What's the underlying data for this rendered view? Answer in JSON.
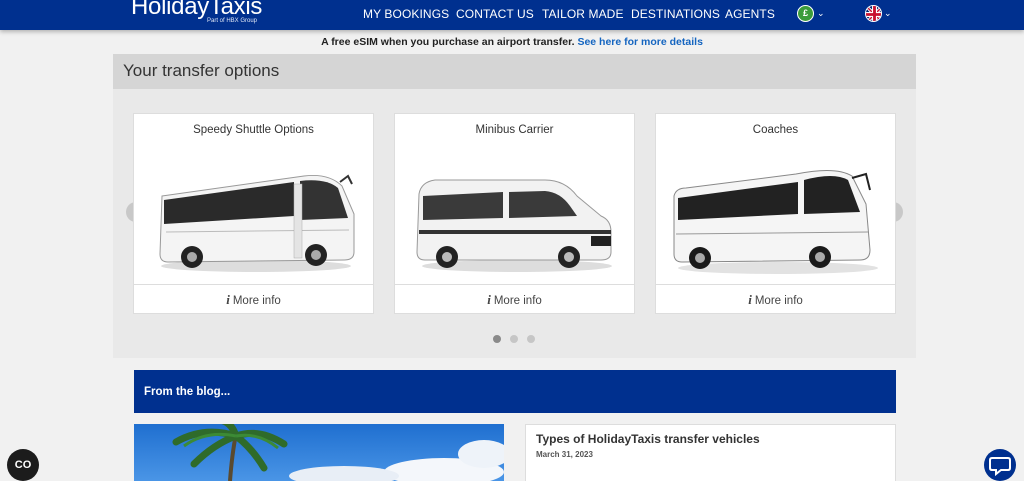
{
  "header": {
    "logo": "HolidayTaxis",
    "logo_sub": "Part of HBX Group",
    "nav": [
      "MY BOOKINGS",
      "CONTACT US",
      "TAILOR MADE",
      "DESTINATIONS",
      "AGENTS"
    ],
    "currency_symbol": "£",
    "colors": {
      "bar": "#00308f",
      "currency": "#3b9c3b"
    }
  },
  "promo": {
    "text": "A free eSIM when you purchase an airport transfer.",
    "link": "See here for more details"
  },
  "transfers": {
    "title": "Your transfer options",
    "cards": [
      {
        "title": "Speedy Shuttle Options",
        "footer": "More info",
        "image_icon": "coach-bus"
      },
      {
        "title": "Minibus Carrier",
        "footer": "More info",
        "image_icon": "minibus"
      },
      {
        "title": "Coaches",
        "footer": "More info",
        "image_icon": "coach-bus"
      }
    ],
    "prev": "‹",
    "next": "›",
    "info_glyph": "i",
    "pages": 3,
    "active_page": 1
  },
  "blog": {
    "heading": "From the blog...",
    "post": {
      "title": "Types of HolidayTaxis transfer vehicles",
      "date": "March 31, 2023"
    }
  },
  "widgets": {
    "co_label": "CO"
  }
}
